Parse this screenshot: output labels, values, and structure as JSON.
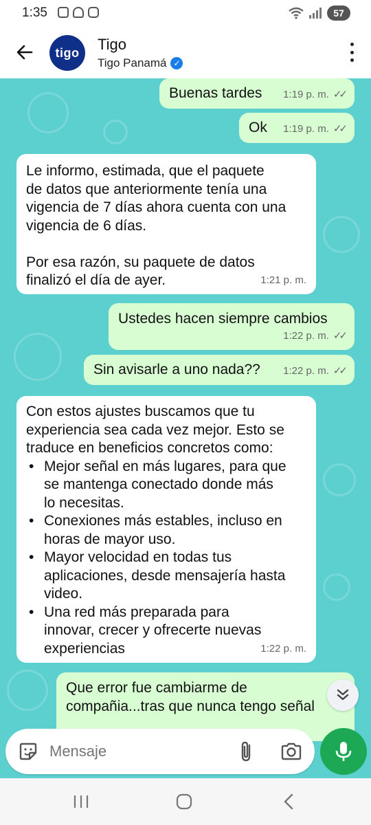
{
  "status_bar": {
    "time": "1:35",
    "battery": "57"
  },
  "header": {
    "avatar_text": "tigo",
    "name": "Tigo",
    "subtitle": "Tigo Panamá"
  },
  "messages": [
    {
      "text": "Buenas tardes",
      "time": "1:19 p. m."
    },
    {
      "text": "Ok",
      "time": "1:19 p. m."
    },
    {
      "text": "Le informo, estimada, que el paquete\nde datos que anteriormente tenía una\nvigencia de 7 días ahora cuenta con una\nvigencia de 6 días.\n\nPor esa razón, su paquete de datos\nfinalizó el día de ayer.",
      "time": "1:21 p. m."
    },
    {
      "text": "Ustedes hacen siempre cambios",
      "time": "1:22 p. m."
    },
    {
      "text": "Sin avisarle a uno nada??",
      "time": "1:22 p. m."
    },
    {
      "text": "Con estos ajustes buscamos que tu\nexperiencia sea cada vez mejor. Esto se\ntraduce en beneficios concretos como:",
      "bullets": [
        "Mejor señal en más lugares, para que\nse mantenga conectado donde más\nlo necesitas.",
        "Conexiones más estables, incluso en\nhoras de mayor uso.",
        "Mayor velocidad en todas tus\naplicaciones, desde mensajería hasta\nvideo.",
        "Una red más preparada para\ninnovar, crecer y ofrecerte nuevas\nexperiencias"
      ],
      "time": "1:22 p. m."
    },
    {
      "text": "Que error fue cambiarme de\ncompañia...tras que nunca tengo señal"
    }
  ],
  "composer": {
    "placeholder": "Mensaje"
  },
  "colors": {
    "chat_bg": "#5ccfcf",
    "outgoing": "#d9fdd3",
    "incoming": "#ffffff",
    "accent": "#1da856"
  },
  "icons": [
    "back-arrow-icon",
    "verified-icon",
    "more-vert-icon",
    "sticker-icon",
    "attach-icon",
    "camera-icon",
    "mic-icon",
    "double-chevron-down-icon",
    "recents-icon",
    "home-icon",
    "back-icon"
  ]
}
